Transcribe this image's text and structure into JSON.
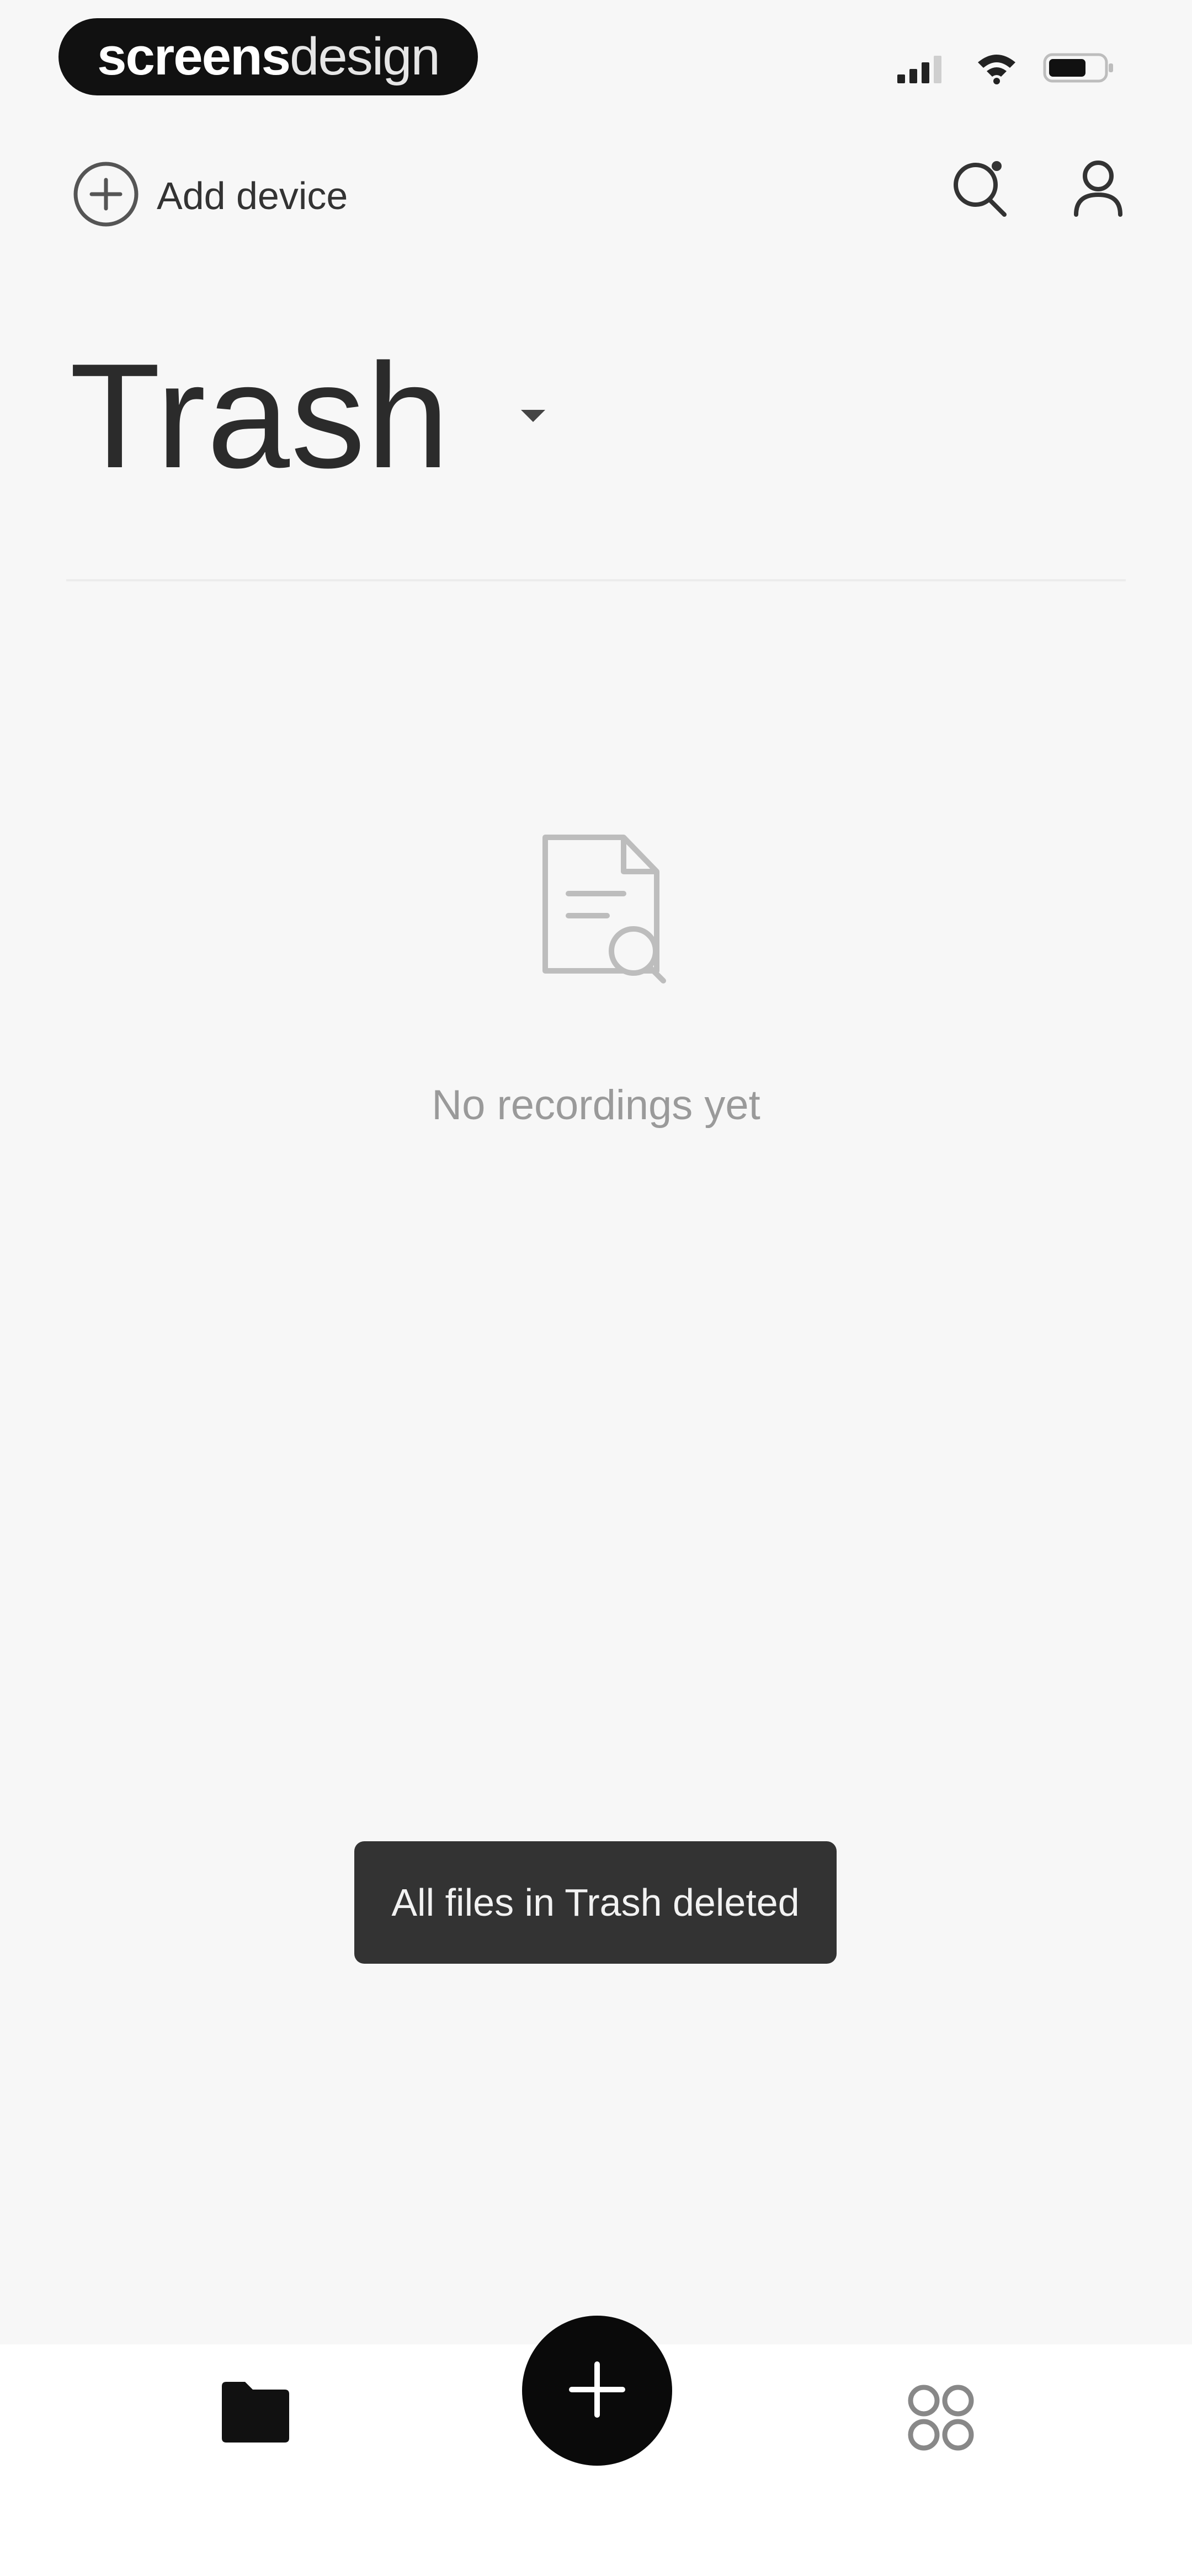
{
  "status_bar": {
    "brand_part1": "screens",
    "brand_part2": "design",
    "signal_icon": "cellular-signal-icon",
    "wifi_icon": "wifi-icon",
    "battery_icon": "battery-icon"
  },
  "header": {
    "add_device_label": "Add device",
    "add_device_icon": "plus-circle-icon",
    "search_icon": "search-icon",
    "profile_icon": "profile-icon"
  },
  "main": {
    "title": "Trash",
    "dropdown_icon": "chevron-down-icon",
    "empty_state": {
      "icon": "document-search-icon",
      "text": "No recordings yet"
    }
  },
  "toast": {
    "message": "All files in Trash deleted"
  },
  "bottom_nav": {
    "folder_icon": "folder-icon",
    "add_icon": "plus-icon",
    "apps_icon": "apps-grid-icon"
  },
  "colors": {
    "background": "#f7f7f7",
    "text_primary": "#2b2b2b",
    "text_muted": "#9a9a9a",
    "toast_bg": "#333333",
    "fab_bg": "#0a0a0a",
    "nav_bg": "#ffffff"
  }
}
